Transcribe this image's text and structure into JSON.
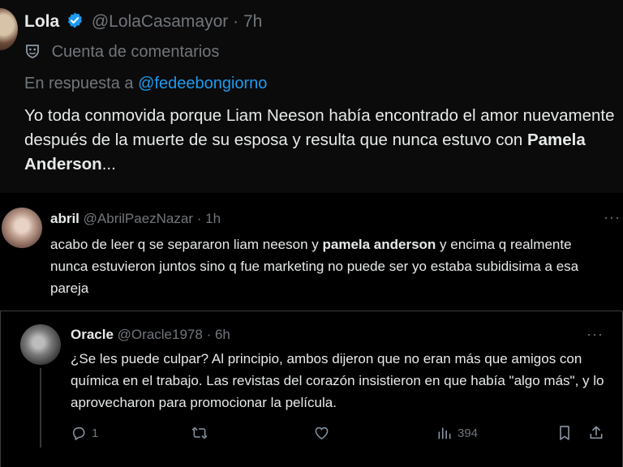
{
  "tweet1": {
    "name": "Lola",
    "handle": "@LolaCasamayor",
    "time": "7h",
    "community": "Cuenta de comentarios",
    "reply_prefix": "En respuesta a",
    "reply_handle": "@fedeebongiorno",
    "body_text": "Yo toda conmovida porque Liam Neeson había encontrado el amor nuevamente después de la muerte de su esposa y resulta que nunca estuvo con ",
    "body_bold": "Pamela Anderson",
    "body_end": "..."
  },
  "tweet2": {
    "name": "abril",
    "handle": "@AbrilPaezNazar",
    "time": "1h",
    "body_text": "acabo de leer q se separaron liam neeson y ",
    "body_bold": "pamela anderson",
    "body_end": " y encima q realmente nunca estuvieron juntos sino q fue marketing no puede ser yo estaba subidisima a esa pareja"
  },
  "tweet3": {
    "name": "Oracle",
    "handle": "@Oracle1978",
    "time": "6h",
    "body": "¿Se les puede culpar? Al principio, ambos dijeron que no eran más que amigos con química en el trabajo. Las revistas del corazón insistieron en que había \"algo más\", y lo aprovecharon para promocionar la película.",
    "replies": "1",
    "views": "394"
  },
  "separator": "·",
  "more_glyph": "···",
  "colors": {
    "accent": "#1d9bf0",
    "muted": "#71767b",
    "text": "#e7e9ea"
  }
}
